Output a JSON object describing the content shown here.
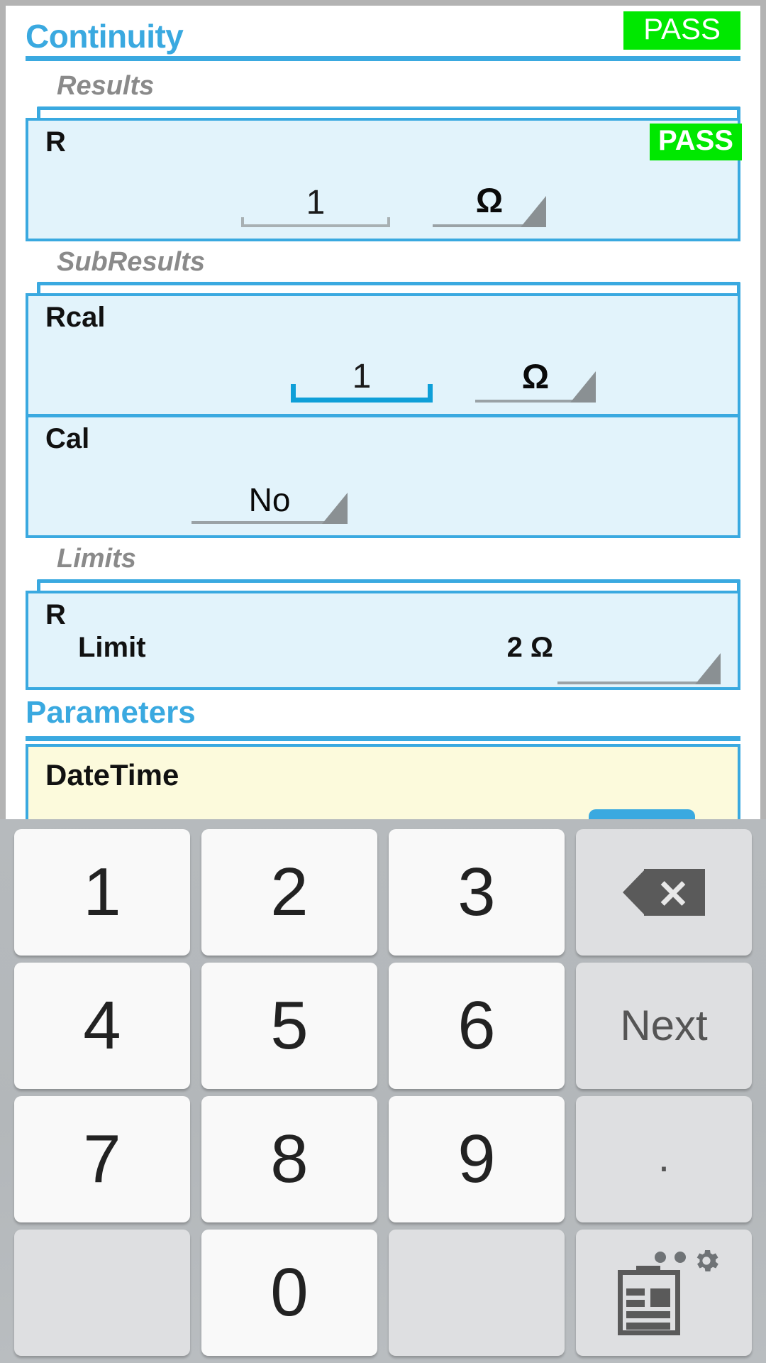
{
  "app": {
    "title": "Continuity",
    "overall_status": "PASS",
    "status_color": "#00e800",
    "accent_color": "#3aa9e0",
    "card_bg": "#e2f3fb",
    "param_bg": "#fcfadc"
  },
  "groups": {
    "results": {
      "label": "Results",
      "rows": [
        {
          "name": "R",
          "value": "1",
          "unit": "Ω",
          "status": "PASS",
          "focused": false
        }
      ]
    },
    "subresults": {
      "label": "SubResults",
      "rows": [
        {
          "name": "Rcal",
          "value": "1",
          "unit": "Ω",
          "focused": true
        },
        {
          "name": "Cal",
          "value": "No",
          "focused": false
        }
      ]
    },
    "limits": {
      "label": "Limits",
      "rows": [
        {
          "name": "R",
          "limit_label": "Limit",
          "limit_value": "2 Ω"
        }
      ]
    }
  },
  "parameters": {
    "title": "Parameters",
    "rows": [
      {
        "name": "DateTime"
      }
    ]
  },
  "keyboard": {
    "rows": [
      [
        {
          "label": "1",
          "type": "digit"
        },
        {
          "label": "2",
          "type": "digit"
        },
        {
          "label": "3",
          "type": "digit"
        },
        {
          "label": "",
          "type": "backspace",
          "icon": "backspace-icon"
        }
      ],
      [
        {
          "label": "4",
          "type": "digit"
        },
        {
          "label": "5",
          "type": "digit"
        },
        {
          "label": "6",
          "type": "digit"
        },
        {
          "label": "Next",
          "type": "action"
        }
      ],
      [
        {
          "label": "7",
          "type": "digit"
        },
        {
          "label": "8",
          "type": "digit"
        },
        {
          "label": "9",
          "type": "digit"
        },
        {
          "label": ".",
          "type": "dot"
        }
      ],
      [
        {
          "label": "",
          "type": "blank"
        },
        {
          "label": "0",
          "type": "digit"
        },
        {
          "label": "",
          "type": "blank"
        },
        {
          "label": "",
          "type": "ime",
          "icon": "clipboard-gear-icon"
        }
      ]
    ]
  }
}
